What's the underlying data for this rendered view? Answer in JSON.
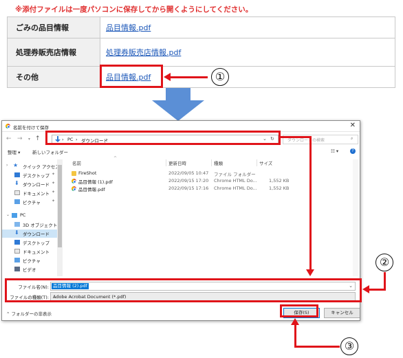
{
  "notice": "※添付ファイルは一度パソコンに保存してから開くようにしてください。",
  "table": {
    "rows": [
      {
        "label": "ごみの品目情報",
        "link": "品目情報.pdf"
      },
      {
        "label": "処理券販売店情報",
        "link": "処理券販売店情報.pdf"
      },
      {
        "label": "その他",
        "link": "品目情報.pdf"
      }
    ]
  },
  "steps": [
    "①",
    "②",
    "③"
  ],
  "dialog": {
    "title": "名前を付けて保存",
    "nav": {
      "back": "←",
      "forward": "→",
      "up": "↑",
      "path": [
        "PC",
        "ダウンロード"
      ],
      "sep": "›",
      "search_placeholder": "ダウンロードの検索"
    },
    "toolbar": {
      "organize": "整理 ▾",
      "new_folder": "新しいフォルダー",
      "view": "☷ ▾",
      "help": "?"
    },
    "tree": [
      {
        "label": "クイック アクセス",
        "icon": "star-icon"
      },
      {
        "label": "デスクトップ",
        "icon": "desktop-icon",
        "pinned": true
      },
      {
        "label": "ダウンロード",
        "icon": "download-icon",
        "pinned": true
      },
      {
        "label": "ドキュメント",
        "icon": "document-icon",
        "pinned": true
      },
      {
        "label": "ピクチャ",
        "icon": "picture-icon",
        "pinned": true
      },
      {
        "label": "PC",
        "icon": "pc-icon"
      },
      {
        "label": "3D オブジェクト",
        "icon": "cube-icon"
      },
      {
        "label": "ダウンロード",
        "icon": "download-icon",
        "selected": true
      },
      {
        "label": "デスクトップ",
        "icon": "desktop-icon"
      },
      {
        "label": "ドキュメント",
        "icon": "document-icon"
      },
      {
        "label": "ピクチャ",
        "icon": "picture-icon"
      },
      {
        "label": "ビデオ",
        "icon": "video-icon"
      }
    ],
    "columns": {
      "name": "名前",
      "modified": "更新日時",
      "type": "種類",
      "size": "サイズ"
    },
    "files": [
      {
        "name": "FireShot",
        "modified": "2022/09/05 10:47",
        "type": "ファイル フォルダー",
        "size": "",
        "icon": "folder-icon"
      },
      {
        "name": "品目情報 (1).pdf",
        "modified": "2022/09/15 17:20",
        "type": "Chrome HTML Do...",
        "size": "1,552 KB",
        "icon": "chrome-icon"
      },
      {
        "name": "品目情報.pdf",
        "modified": "2022/09/15 17:16",
        "type": "Chrome HTML Do...",
        "size": "1,552 KB",
        "icon": "chrome-icon"
      }
    ],
    "filename_label": "ファイル名(N):",
    "filename_value": "品目情報 (2).pdf",
    "filetype_label": "ファイルの種類(T):",
    "filetype_value": "Adobe Acrobat Document (*.pdf)",
    "hide_folders": "フォルダーの非表示",
    "save": "保存(S)",
    "cancel": "キャンセル"
  },
  "colors": {
    "highlight": "#e0141a",
    "arrow": "#5b8fd6",
    "link": "#1a56b8",
    "notice": "#e03030"
  }
}
